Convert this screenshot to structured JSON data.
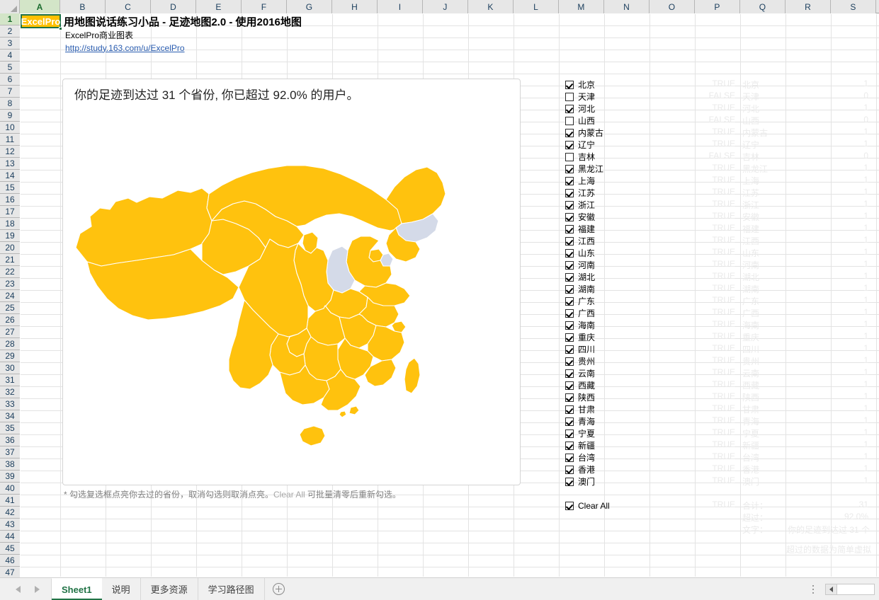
{
  "workbook": {
    "columns": [
      "A",
      "B",
      "C",
      "D",
      "E",
      "F",
      "G",
      "H",
      "I",
      "J",
      "K",
      "L",
      "M",
      "N",
      "O",
      "P",
      "Q",
      "R",
      "S"
    ],
    "selected_cell": "A1",
    "selected_cell_value": "ExcelPro",
    "row_count": 47
  },
  "header": {
    "title": "用地图说话练习小品 - 足迹地图2.0 - 使用2016地图",
    "subtitle": "ExcelPro商业图表",
    "link": "http://study.163.com/u/ExcelPro"
  },
  "chart": {
    "title": "你的足迹到达过 31 个省份, 你已超过 92.0% 的用户。",
    "note_prefix": "* 勾选复选框点亮你去过的省份，取消勾选则取消点亮。",
    "note_highlight": "Clear All",
    "note_suffix": " 可批量清零后重新勾选。",
    "color_selected": "#FFC20E",
    "color_unselected": "#D4DAE8",
    "color_border": "#FFFFFF"
  },
  "checkboxes": [
    {
      "label": "北京",
      "checked": true
    },
    {
      "label": "天津",
      "checked": false
    },
    {
      "label": "河北",
      "checked": true
    },
    {
      "label": "山西",
      "checked": false
    },
    {
      "label": "内蒙古",
      "checked": true
    },
    {
      "label": "辽宁",
      "checked": true
    },
    {
      "label": "吉林",
      "checked": false
    },
    {
      "label": "黑龙江",
      "checked": true
    },
    {
      "label": "上海",
      "checked": true
    },
    {
      "label": "江苏",
      "checked": true
    },
    {
      "label": "浙江",
      "checked": true
    },
    {
      "label": "安徽",
      "checked": true
    },
    {
      "label": "福建",
      "checked": true
    },
    {
      "label": "江西",
      "checked": true
    },
    {
      "label": "山东",
      "checked": true
    },
    {
      "label": "河南",
      "checked": true
    },
    {
      "label": "湖北",
      "checked": true
    },
    {
      "label": "湖南",
      "checked": true
    },
    {
      "label": "广东",
      "checked": true
    },
    {
      "label": "广西",
      "checked": true
    },
    {
      "label": "海南",
      "checked": true
    },
    {
      "label": "重庆",
      "checked": true
    },
    {
      "label": "四川",
      "checked": true
    },
    {
      "label": "贵州",
      "checked": true
    },
    {
      "label": "云南",
      "checked": true
    },
    {
      "label": "西藏",
      "checked": true
    },
    {
      "label": "陕西",
      "checked": true
    },
    {
      "label": "甘肃",
      "checked": true
    },
    {
      "label": "青海",
      "checked": true
    },
    {
      "label": "宁夏",
      "checked": true
    },
    {
      "label": "新疆",
      "checked": true
    },
    {
      "label": "台湾",
      "checked": true
    },
    {
      "label": "香港",
      "checked": true
    },
    {
      "label": "澳门",
      "checked": true
    }
  ],
  "clear_all": {
    "label": "Clear All",
    "checked": true,
    "bool": "TRUE"
  },
  "helper_table": {
    "rows": [
      {
        "bool": "TRUE",
        "name": "北京",
        "value": "1"
      },
      {
        "bool": "FALSE",
        "name": "天津",
        "value": "0"
      },
      {
        "bool": "TRUE",
        "name": "河北",
        "value": "1"
      },
      {
        "bool": "FALSE",
        "name": "山西",
        "value": "0"
      },
      {
        "bool": "TRUE",
        "name": "内蒙古",
        "value": "1"
      },
      {
        "bool": "TRUE",
        "name": "辽宁",
        "value": "1"
      },
      {
        "bool": "FALSE",
        "name": "吉林",
        "value": "0"
      },
      {
        "bool": "TRUE",
        "name": "黑龙江",
        "value": "1"
      },
      {
        "bool": "TRUE",
        "name": "上海",
        "value": "1"
      },
      {
        "bool": "TRUE",
        "name": "江苏",
        "value": "1"
      },
      {
        "bool": "TRUE",
        "name": "浙江",
        "value": "1"
      },
      {
        "bool": "TRUE",
        "name": "安徽",
        "value": "1"
      },
      {
        "bool": "TRUE",
        "name": "福建",
        "value": "1"
      },
      {
        "bool": "TRUE",
        "name": "江西",
        "value": "1"
      },
      {
        "bool": "TRUE",
        "name": "山东",
        "value": "1"
      },
      {
        "bool": "TRUE",
        "name": "河南",
        "value": "1"
      },
      {
        "bool": "TRUE",
        "name": "湖北",
        "value": "1"
      },
      {
        "bool": "TRUE",
        "name": "湖南",
        "value": "1"
      },
      {
        "bool": "TRUE",
        "name": "广东",
        "value": "1"
      },
      {
        "bool": "TRUE",
        "name": "广西",
        "value": "1"
      },
      {
        "bool": "TRUE",
        "name": "海南",
        "value": "1"
      },
      {
        "bool": "TRUE",
        "name": "重庆",
        "value": "1"
      },
      {
        "bool": "TRUE",
        "name": "四川",
        "value": "1"
      },
      {
        "bool": "TRUE",
        "name": "贵州",
        "value": "1"
      },
      {
        "bool": "TRUE",
        "name": "云南",
        "value": "1"
      },
      {
        "bool": "TRUE",
        "name": "西藏",
        "value": "1"
      },
      {
        "bool": "TRUE",
        "name": "陕西",
        "value": "1"
      },
      {
        "bool": "TRUE",
        "name": "甘肃",
        "value": "1"
      },
      {
        "bool": "TRUE",
        "name": "青海",
        "value": "1"
      },
      {
        "bool": "TRUE",
        "name": "宁夏",
        "value": "1"
      },
      {
        "bool": "TRUE",
        "name": "新疆",
        "value": "1"
      },
      {
        "bool": "TRUE",
        "name": "台湾",
        "value": "1"
      },
      {
        "bool": "TRUE",
        "name": "香港",
        "value": "1"
      },
      {
        "bool": "TRUE",
        "name": "澳门",
        "value": "1"
      }
    ],
    "summary": [
      {
        "label": "合计：",
        "value": "31"
      },
      {
        "label": "超过：",
        "value": "92.0%"
      },
      {
        "label": "文字：",
        "value": "你的足迹到达过 31 个"
      }
    ],
    "footnote": "超过的数据为简单虚拟"
  },
  "chart_data": {
    "type": "map",
    "title": "你的足迹到达过 31 个省份, 你已超过 92.0% 的用户。",
    "region": "China (2016 administrative map)",
    "total_provinces": 34,
    "visited_count": 31,
    "percentile": "92.0%",
    "legend": {
      "visited": "#FFC20E",
      "not_visited": "#D4DAE8"
    },
    "provinces": [
      {
        "name": "北京",
        "visited": 1
      },
      {
        "name": "天津",
        "visited": 0
      },
      {
        "name": "河北",
        "visited": 1
      },
      {
        "name": "山西",
        "visited": 0
      },
      {
        "name": "内蒙古",
        "visited": 1
      },
      {
        "name": "辽宁",
        "visited": 1
      },
      {
        "name": "吉林",
        "visited": 0
      },
      {
        "name": "黑龙江",
        "visited": 1
      },
      {
        "name": "上海",
        "visited": 1
      },
      {
        "name": "江苏",
        "visited": 1
      },
      {
        "name": "浙江",
        "visited": 1
      },
      {
        "name": "安徽",
        "visited": 1
      },
      {
        "name": "福建",
        "visited": 1
      },
      {
        "name": "江西",
        "visited": 1
      },
      {
        "name": "山东",
        "visited": 1
      },
      {
        "name": "河南",
        "visited": 1
      },
      {
        "name": "湖北",
        "visited": 1
      },
      {
        "name": "湖南",
        "visited": 1
      },
      {
        "name": "广东",
        "visited": 1
      },
      {
        "name": "广西",
        "visited": 1
      },
      {
        "name": "海南",
        "visited": 1
      },
      {
        "name": "重庆",
        "visited": 1
      },
      {
        "name": "四川",
        "visited": 1
      },
      {
        "name": "贵州",
        "visited": 1
      },
      {
        "name": "云南",
        "visited": 1
      },
      {
        "name": "西藏",
        "visited": 1
      },
      {
        "name": "陕西",
        "visited": 1
      },
      {
        "name": "甘肃",
        "visited": 1
      },
      {
        "name": "青海",
        "visited": 1
      },
      {
        "name": "宁夏",
        "visited": 1
      },
      {
        "name": "新疆",
        "visited": 1
      },
      {
        "name": "台湾",
        "visited": 1
      },
      {
        "name": "香港",
        "visited": 1
      },
      {
        "name": "澳门",
        "visited": 1
      }
    ]
  },
  "tabs": {
    "items": [
      {
        "label": "Sheet1",
        "active": true
      },
      {
        "label": "说明",
        "active": false
      },
      {
        "label": "更多资源",
        "active": false
      },
      {
        "label": "学习路径图",
        "active": false
      }
    ]
  }
}
